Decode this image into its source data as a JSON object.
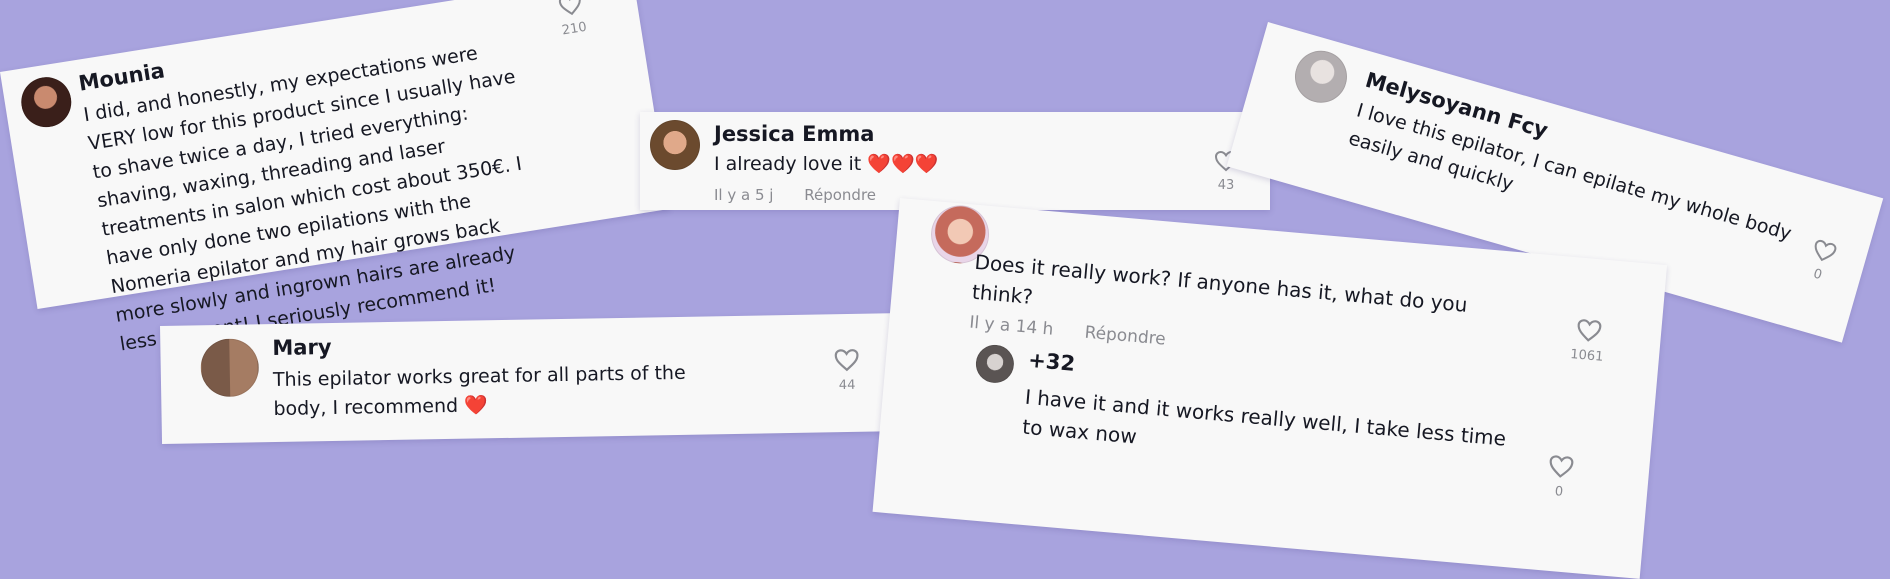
{
  "comments": {
    "mounia": {
      "name": "Mounia",
      "text": "I did, and honestly, my expectations were VERY low for this product since I usually have to shave twice a day, I tried everything: shaving, waxing, threading and laser treatments in salon which cost about 350€. I have only done two epilations with the Nomeria epilator and my hair grows back more slowly and ingrown hairs are already less frequent! I seriously recommend it!",
      "likes": "210"
    },
    "jessica": {
      "name": "Jessica Emma",
      "text": "I already love it",
      "emoji": "❤️❤️❤️",
      "time": "Il y a 5 j",
      "reply": "Répondre",
      "likes": "43"
    },
    "melysoyann": {
      "name": "Melysoyann Fcy",
      "text": "I love this epilator, I can epilate my whole body easily and quickly",
      "likes": "0"
    },
    "mary": {
      "name": "Mary",
      "text": "This epilator works great for all parts of the body, I recommend",
      "emoji": "❤️",
      "likes": "44"
    },
    "question": {
      "text": "Does it really work? If anyone has it, what do you think?",
      "time": "Il y a 14 h",
      "reply": "Répondre",
      "likes": "1061"
    },
    "reply32": {
      "name": "+32",
      "text": "I have it and it works really well, I take less time to wax now",
      "likes": "0"
    }
  },
  "colors": {
    "background": "#a8a3de",
    "card": "#f8f8f8",
    "text": "#161823",
    "muted": "#8a8b91",
    "heart": "#e8222b"
  },
  "icons": [
    "heart-outline-icon",
    "red-heart-emoji"
  ]
}
